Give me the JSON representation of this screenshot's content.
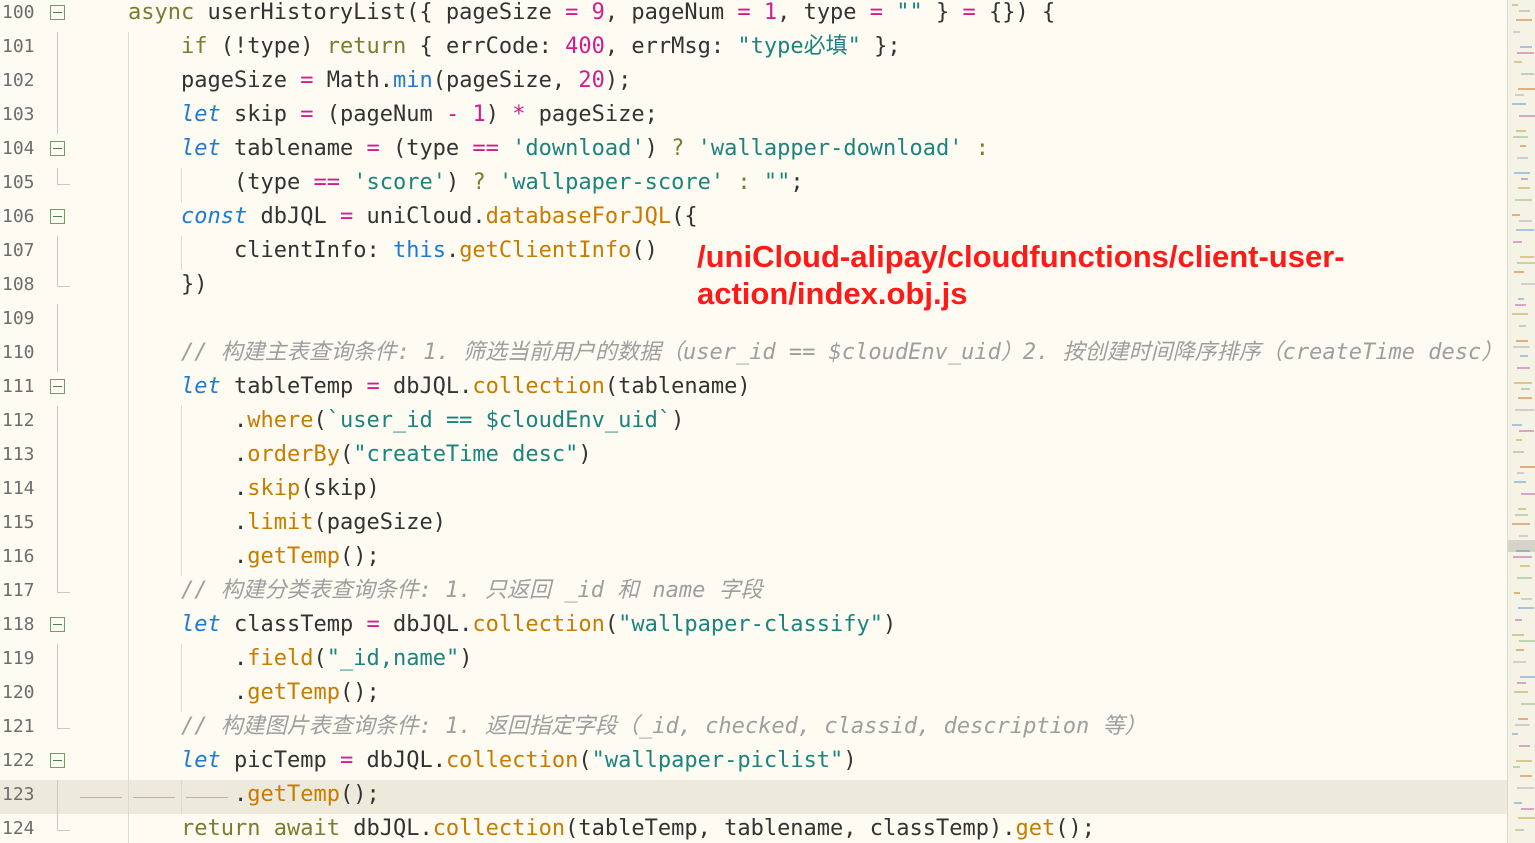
{
  "editor": {
    "annotation": "/uniCloud-alipay/cloudfunctions/client-user-action/index.obj.js",
    "current_line": 123,
    "lines": [
      {
        "n": "100",
        "fold": "open",
        "tokens": [
          [
            "kw",
            "async "
          ],
          [
            "prop",
            "userHistoryList"
          ],
          [
            "prop",
            "({ pageSize "
          ],
          [
            "op",
            "="
          ],
          [
            "prop",
            " "
          ],
          [
            "num",
            "9"
          ],
          [
            "prop",
            ", pageNum "
          ],
          [
            "op",
            "="
          ],
          [
            "prop",
            " "
          ],
          [
            "num",
            "1"
          ],
          [
            "prop",
            ", type "
          ],
          [
            "op",
            "="
          ],
          [
            "prop",
            " "
          ],
          [
            "str",
            "\"\""
          ],
          [
            "prop",
            " } "
          ],
          [
            "op",
            "="
          ],
          [
            "prop",
            " {}) {"
          ]
        ],
        "indent": 128
      },
      {
        "n": "101",
        "fold": "line",
        "tokens": [
          [
            "kw",
            "if"
          ],
          [
            "prop",
            " (!type) "
          ],
          [
            "kw",
            "return"
          ],
          [
            "prop",
            " { errCode: "
          ],
          [
            "num",
            "400"
          ],
          [
            "prop",
            ", errMsg: "
          ],
          [
            "str",
            "\"type必填\""
          ],
          [
            "prop",
            " };"
          ]
        ],
        "indent": 181
      },
      {
        "n": "102",
        "fold": "line",
        "tokens": [
          [
            "prop",
            "pageSize "
          ],
          [
            "op",
            "="
          ],
          [
            "prop",
            " Math."
          ],
          [
            "kw3",
            "min"
          ],
          [
            "prop",
            "(pageSize, "
          ],
          [
            "num",
            "20"
          ],
          [
            "prop",
            ");"
          ]
        ],
        "indent": 181
      },
      {
        "n": "103",
        "fold": "line",
        "tokens": [
          [
            "kw2",
            "let"
          ],
          [
            "prop",
            " skip "
          ],
          [
            "op",
            "="
          ],
          [
            "prop",
            " (pageNum "
          ],
          [
            "op",
            "-"
          ],
          [
            "prop",
            " "
          ],
          [
            "num",
            "1"
          ],
          [
            "prop",
            ") "
          ],
          [
            "op",
            "*"
          ],
          [
            "prop",
            " pageSize;"
          ]
        ],
        "indent": 181
      },
      {
        "n": "104",
        "fold": "open",
        "tokens": [
          [
            "kw2",
            "let"
          ],
          [
            "prop",
            " tablename "
          ],
          [
            "op",
            "="
          ],
          [
            "prop",
            " (type "
          ],
          [
            "op",
            "=="
          ],
          [
            "prop",
            " "
          ],
          [
            "str",
            "'download'"
          ],
          [
            "prop",
            ") "
          ],
          [
            "kw",
            "?"
          ],
          [
            "prop",
            " "
          ],
          [
            "str",
            "'wallapper-download'"
          ],
          [
            "prop",
            " "
          ],
          [
            "kw",
            ":"
          ]
        ],
        "indent": 181
      },
      {
        "n": "105",
        "fold": "end",
        "tokens": [
          [
            "prop",
            "(type "
          ],
          [
            "op",
            "=="
          ],
          [
            "prop",
            " "
          ],
          [
            "str",
            "'score'"
          ],
          [
            "prop",
            ") "
          ],
          [
            "kw",
            "?"
          ],
          [
            "prop",
            " "
          ],
          [
            "str",
            "'wallpaper-score'"
          ],
          [
            "prop",
            " "
          ],
          [
            "kw",
            ":"
          ],
          [
            "prop",
            " "
          ],
          [
            "str",
            "\"\""
          ],
          [
            "prop",
            ";"
          ]
        ],
        "indent": 234
      },
      {
        "n": "106",
        "fold": "open",
        "tokens": [
          [
            "kw2",
            "const"
          ],
          [
            "prop",
            " dbJQL "
          ],
          [
            "op",
            "="
          ],
          [
            "prop",
            " uniCloud."
          ],
          [
            "fn",
            "databaseForJQL"
          ],
          [
            "prop",
            "({"
          ]
        ],
        "indent": 181
      },
      {
        "n": "107",
        "fold": "line",
        "tokens": [
          [
            "prop",
            "clientInfo: "
          ],
          [
            "kw3",
            "this"
          ],
          [
            "prop",
            "."
          ],
          [
            "fn",
            "getClientInfo"
          ],
          [
            "prop",
            "()"
          ]
        ],
        "indent": 234
      },
      {
        "n": "108",
        "fold": "end",
        "tokens": [
          [
            "prop",
            "})"
          ]
        ],
        "indent": 181
      },
      {
        "n": "109",
        "fold": "line",
        "tokens": [],
        "indent": 181
      },
      {
        "n": "110",
        "fold": "line",
        "tokens": [
          [
            "comment",
            "// 构建主表查询条件: 1. 筛选当前用户的数据（user_id == $cloudEnv_uid）2. 按创建时间降序排序（createTime desc）"
          ]
        ],
        "indent": 181
      },
      {
        "n": "111",
        "fold": "open",
        "tokens": [
          [
            "kw2",
            "let"
          ],
          [
            "prop",
            " tableTemp "
          ],
          [
            "op",
            "="
          ],
          [
            "prop",
            " dbJQL."
          ],
          [
            "fn",
            "collection"
          ],
          [
            "prop",
            "(tablename)"
          ]
        ],
        "indent": 181
      },
      {
        "n": "112",
        "fold": "line",
        "tokens": [
          [
            "prop",
            "."
          ],
          [
            "fn",
            "where"
          ],
          [
            "prop",
            "("
          ],
          [
            "str",
            "`user_id == $cloudEnv_uid`"
          ],
          [
            "prop",
            ")"
          ]
        ],
        "indent": 234
      },
      {
        "n": "113",
        "fold": "line",
        "tokens": [
          [
            "prop",
            "."
          ],
          [
            "fn",
            "orderBy"
          ],
          [
            "prop",
            "("
          ],
          [
            "str",
            "\"createTime desc\""
          ],
          [
            "prop",
            ")"
          ]
        ],
        "indent": 234
      },
      {
        "n": "114",
        "fold": "line",
        "tokens": [
          [
            "prop",
            "."
          ],
          [
            "fn",
            "skip"
          ],
          [
            "prop",
            "(skip)"
          ]
        ],
        "indent": 234
      },
      {
        "n": "115",
        "fold": "line",
        "tokens": [
          [
            "prop",
            "."
          ],
          [
            "fn",
            "limit"
          ],
          [
            "prop",
            "(pageSize)"
          ]
        ],
        "indent": 234
      },
      {
        "n": "116",
        "fold": "line",
        "tokens": [
          [
            "prop",
            "."
          ],
          [
            "fn",
            "getTemp"
          ],
          [
            "prop",
            "();"
          ]
        ],
        "indent": 234
      },
      {
        "n": "117",
        "fold": "end",
        "tokens": [
          [
            "comment",
            "// 构建分类表查询条件: 1. 只返回 _id 和 name 字段"
          ]
        ],
        "indent": 181
      },
      {
        "n": "118",
        "fold": "open",
        "tokens": [
          [
            "kw2",
            "let"
          ],
          [
            "prop",
            " classTemp "
          ],
          [
            "op",
            "="
          ],
          [
            "prop",
            " dbJQL."
          ],
          [
            "fn",
            "collection"
          ],
          [
            "prop",
            "("
          ],
          [
            "str",
            "\"wallpaper-classify\""
          ],
          [
            "prop",
            ")"
          ]
        ],
        "indent": 181
      },
      {
        "n": "119",
        "fold": "line",
        "tokens": [
          [
            "prop",
            "."
          ],
          [
            "fn",
            "field"
          ],
          [
            "prop",
            "("
          ],
          [
            "str",
            "\"_id,name\""
          ],
          [
            "prop",
            ")"
          ]
        ],
        "indent": 234
      },
      {
        "n": "120",
        "fold": "line",
        "tokens": [
          [
            "prop",
            "."
          ],
          [
            "fn",
            "getTemp"
          ],
          [
            "prop",
            "();"
          ]
        ],
        "indent": 234
      },
      {
        "n": "121",
        "fold": "end",
        "tokens": [
          [
            "comment",
            "// 构建图片表查询条件: 1. 返回指定字段（_id, checked, classid, description 等）"
          ]
        ],
        "indent": 181
      },
      {
        "n": "122",
        "fold": "open",
        "tokens": [
          [
            "kw2",
            "let"
          ],
          [
            "prop",
            " picTemp "
          ],
          [
            "op",
            "="
          ],
          [
            "prop",
            " dbJQL."
          ],
          [
            "fn",
            "collection"
          ],
          [
            "prop",
            "("
          ],
          [
            "str",
            "\"wallpaper-piclist\""
          ],
          [
            "prop",
            ")"
          ]
        ],
        "indent": 181
      },
      {
        "n": "123",
        "fold": "line",
        "tokens": [
          [
            "prop",
            "."
          ],
          [
            "fn",
            "getTemp"
          ],
          [
            "prop",
            "();"
          ]
        ],
        "indent": 234
      },
      {
        "n": "124",
        "fold": "end",
        "tokens": [
          [
            "ret",
            "return"
          ],
          [
            "prop",
            " "
          ],
          [
            "ret",
            "await"
          ],
          [
            "prop",
            " dbJQL."
          ],
          [
            "fn",
            "collection"
          ],
          [
            "prop",
            "(tableTemp, tablename, classTemp)."
          ],
          [
            "fn",
            "get"
          ],
          [
            "prop",
            "();"
          ]
        ],
        "indent": 181
      }
    ]
  }
}
